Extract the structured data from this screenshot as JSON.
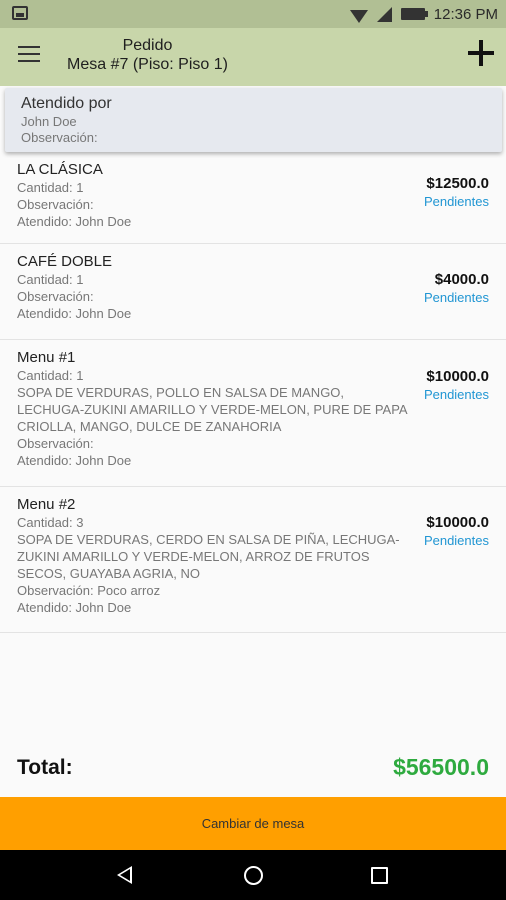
{
  "status_bar": {
    "time": "12:36 PM",
    "icons": [
      "notification-icon",
      "wifi-icon",
      "signal-icon",
      "battery-icon"
    ]
  },
  "app_bar": {
    "title_line1": "Pedido",
    "title_line2": "Mesa #7 (Piso: Piso 1)",
    "icons": [
      "menu-icon",
      "add-icon"
    ]
  },
  "attended": {
    "heading": "Atendido por",
    "name": "John Doe",
    "observation": "Observación:"
  },
  "items": [
    {
      "title": "LA CLÁSICA",
      "lines": [
        "Cantidad: 1",
        "Observación:",
        "Atendido: John Doe"
      ],
      "price": "$12500.0",
      "status": "Pendientes"
    },
    {
      "title": "CAFÉ DOBLE",
      "lines": [
        "Cantidad: 1",
        "Observación:",
        "Atendido: John Doe"
      ],
      "price": "$4000.0",
      "status": "Pendientes"
    },
    {
      "title": "Menu #1",
      "lines": [
        "Cantidad: 1",
        "SOPA DE VERDURAS, POLLO EN SALSA DE MANGO, LECHUGA-ZUKINI AMARILLO Y VERDE-MELON, PURE DE PAPA CRIOLLA, MANGO, DULCE DE ZANAHORIA",
        "Observación:",
        "Atendido: John Doe"
      ],
      "price": "$10000.0",
      "status": "Pendientes"
    },
    {
      "title": "Menu #2",
      "lines": [
        "Cantidad: 3",
        "SOPA DE VERDURAS, CERDO EN SALSA DE PIÑA, LECHUGA-ZUKINI AMARILLO Y VERDE-MELON, ARROZ DE FRUTOS SECOS, GUAYABA AGRIA, NO",
        "Observación: Poco arroz",
        "Atendido: John Doe"
      ],
      "price": "$10000.0",
      "status": "Pendientes"
    }
  ],
  "total": {
    "label": "Total:",
    "value": "$56500.0"
  },
  "change_table_label": "Cambiar de mesa",
  "nav": [
    "back-icon",
    "home-icon",
    "recents-icon"
  ],
  "colors": {
    "status_bar": "#b1bf94",
    "app_bar": "#c8d6aa",
    "accent_link": "#2196d3",
    "total_green": "#2eaa3f",
    "button_orange": "#ff9f00"
  }
}
